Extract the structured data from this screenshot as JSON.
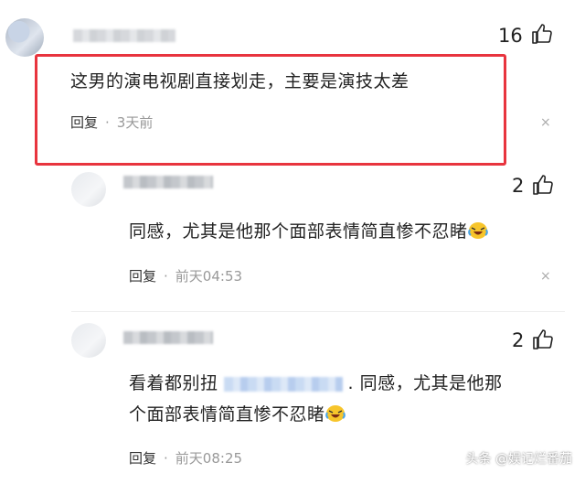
{
  "comments": [
    {
      "likes": "16",
      "text": "这男的演电视剧直接划走，主要是演技太差",
      "reply_label": "回复",
      "dot": "·",
      "time": "3天前"
    },
    {
      "likes": "2",
      "text": "同感，尤其是他那个面部表情简直惨不忍睹",
      "reply_label": "回复",
      "dot": "·",
      "time": "前天04:53"
    },
    {
      "likes": "2",
      "text_prefix": "看着都别扭",
      "text_line1_suffix": ". 同感，尤其是他那",
      "text_line2": "个面部表情简直惨不忍睹",
      "reply_label": "回复",
      "dot": "·",
      "time": "前天08:25"
    }
  ],
  "close_glyph": "×",
  "watermark": "头条 @娱记烂番茄",
  "colors": {
    "highlight": "#e8343e"
  },
  "icons": [
    "thumb-up-icon",
    "close-icon",
    "laugh-cry-emoji-icon"
  ]
}
